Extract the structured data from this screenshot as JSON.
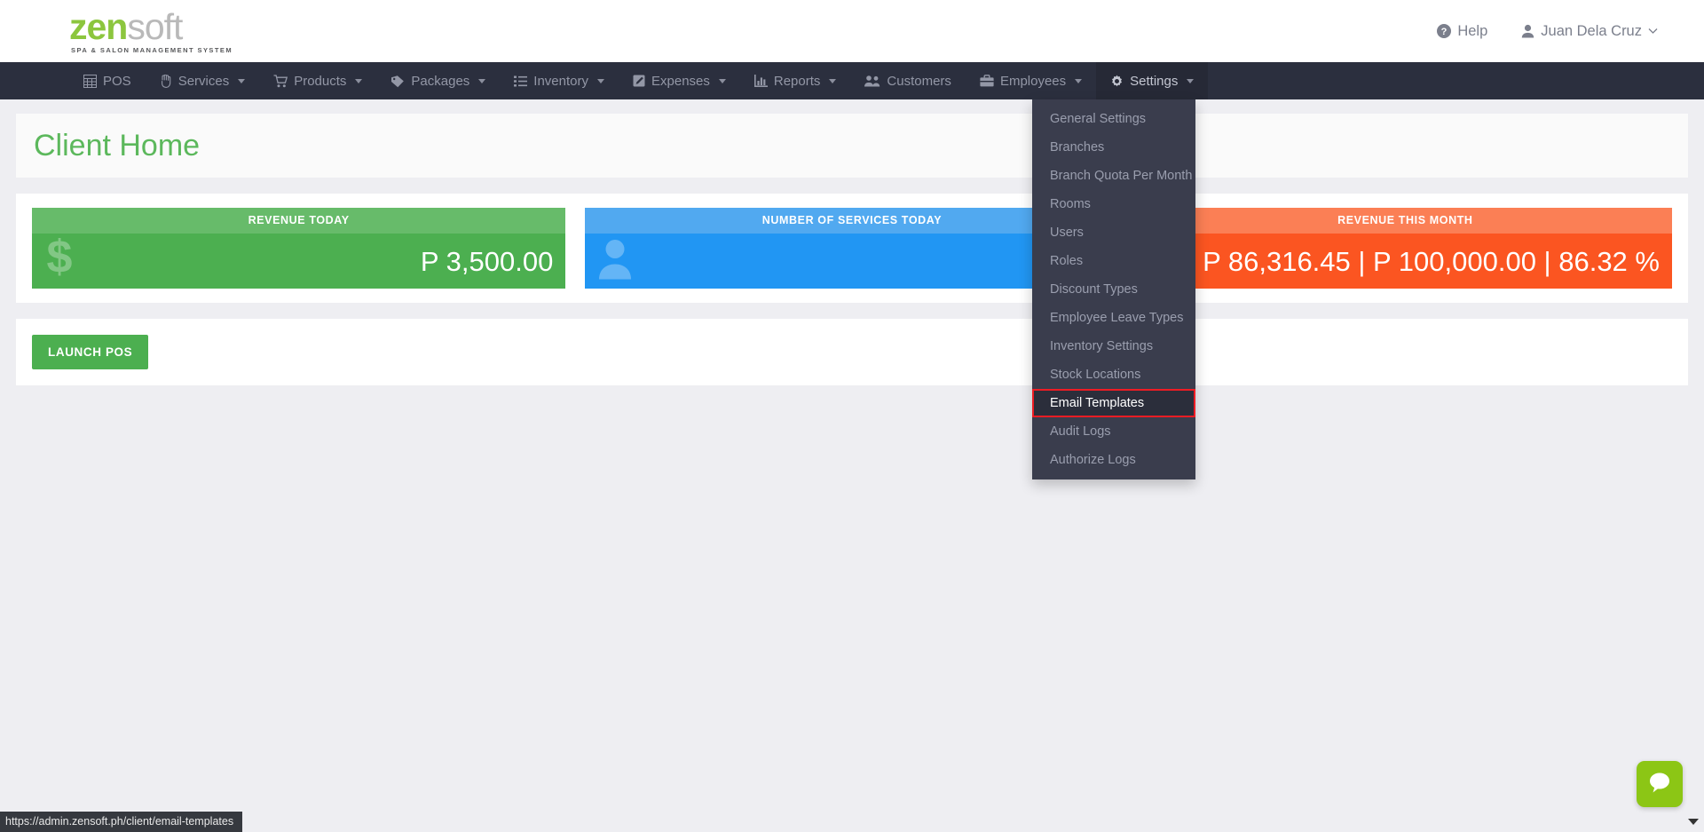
{
  "brand": {
    "logo_zen": "zen",
    "logo_soft": "soft",
    "tagline": "SPA & SALON MANAGEMENT SYSTEM",
    "green": "#8cc63e",
    "gray": "#b9b9b9"
  },
  "topbar": {
    "help_label": "Help",
    "help_icon": "question-circle-icon",
    "user_name": "Juan Dela Cruz",
    "user_icon": "user-icon",
    "caret_icon": "chevron-down-icon"
  },
  "nav": {
    "items": [
      {
        "label": "POS",
        "icon": "calculator-icon",
        "has_caret": false,
        "active": false
      },
      {
        "label": "Services",
        "icon": "hand-icon",
        "has_caret": true,
        "active": false
      },
      {
        "label": "Products",
        "icon": "shopping-cart-icon",
        "has_caret": true,
        "active": false
      },
      {
        "label": "Packages",
        "icon": "tag-icon",
        "has_caret": true,
        "active": false
      },
      {
        "label": "Inventory",
        "icon": "list-icon",
        "has_caret": true,
        "active": false
      },
      {
        "label": "Expenses",
        "icon": "pencil-square-icon",
        "has_caret": true,
        "active": false
      },
      {
        "label": "Reports",
        "icon": "bar-chart-icon",
        "has_caret": true,
        "active": false
      },
      {
        "label": "Customers",
        "icon": "users-icon",
        "has_caret": false,
        "active": false
      },
      {
        "label": "Employees",
        "icon": "briefcase-icon",
        "has_caret": true,
        "active": false
      },
      {
        "label": "Settings",
        "icon": "gear-icon",
        "has_caret": true,
        "active": true
      }
    ]
  },
  "settings_dropdown": {
    "items": [
      {
        "label": "General Settings",
        "highlighted": false
      },
      {
        "label": "Branches",
        "highlighted": false
      },
      {
        "label": "Branch Quota Per Month",
        "highlighted": false
      },
      {
        "label": "Rooms",
        "highlighted": false
      },
      {
        "label": "Users",
        "highlighted": false
      },
      {
        "label": "Roles",
        "highlighted": false
      },
      {
        "label": "Discount Types",
        "highlighted": false
      },
      {
        "label": "Employee Leave Types",
        "highlighted": false
      },
      {
        "label": "Inventory Settings",
        "highlighted": false
      },
      {
        "label": "Stock Locations",
        "highlighted": false
      },
      {
        "label": "Email Templates",
        "highlighted": true
      },
      {
        "label": "Audit Logs",
        "highlighted": false
      },
      {
        "label": "Authorize Logs",
        "highlighted": false
      }
    ],
    "highlight_color": "#ee1c24"
  },
  "page": {
    "title": "Client Home",
    "title_color": "#5cb85c"
  },
  "stats": [
    {
      "header": "REVENUE TODAY",
      "value": "P 3,500.00",
      "icon": "dollar-sign-icon",
      "color": "#4caf50",
      "header_color": "#67bb6a"
    },
    {
      "header": "NUMBER OF SERVICES TODAY",
      "value": "",
      "icon": "user-icon",
      "color": "#2196f3",
      "header_color": "#51a9f0"
    },
    {
      "header": "REVENUE THIS MONTH",
      "value": "P 86,316.45 | P 100,000.00 | 86.32 %",
      "icon": "",
      "color": "#fb5521",
      "header_color": "#fb7f55"
    }
  ],
  "actions": {
    "launch_pos_label": "LAUNCH POS"
  },
  "chat": {
    "icon": "chat-bubble-icon",
    "color": "#8cc615",
    "caret_icon": "caret-down-icon"
  },
  "statusbar": {
    "url": "https://admin.zensoft.ph/client/email-templates"
  }
}
